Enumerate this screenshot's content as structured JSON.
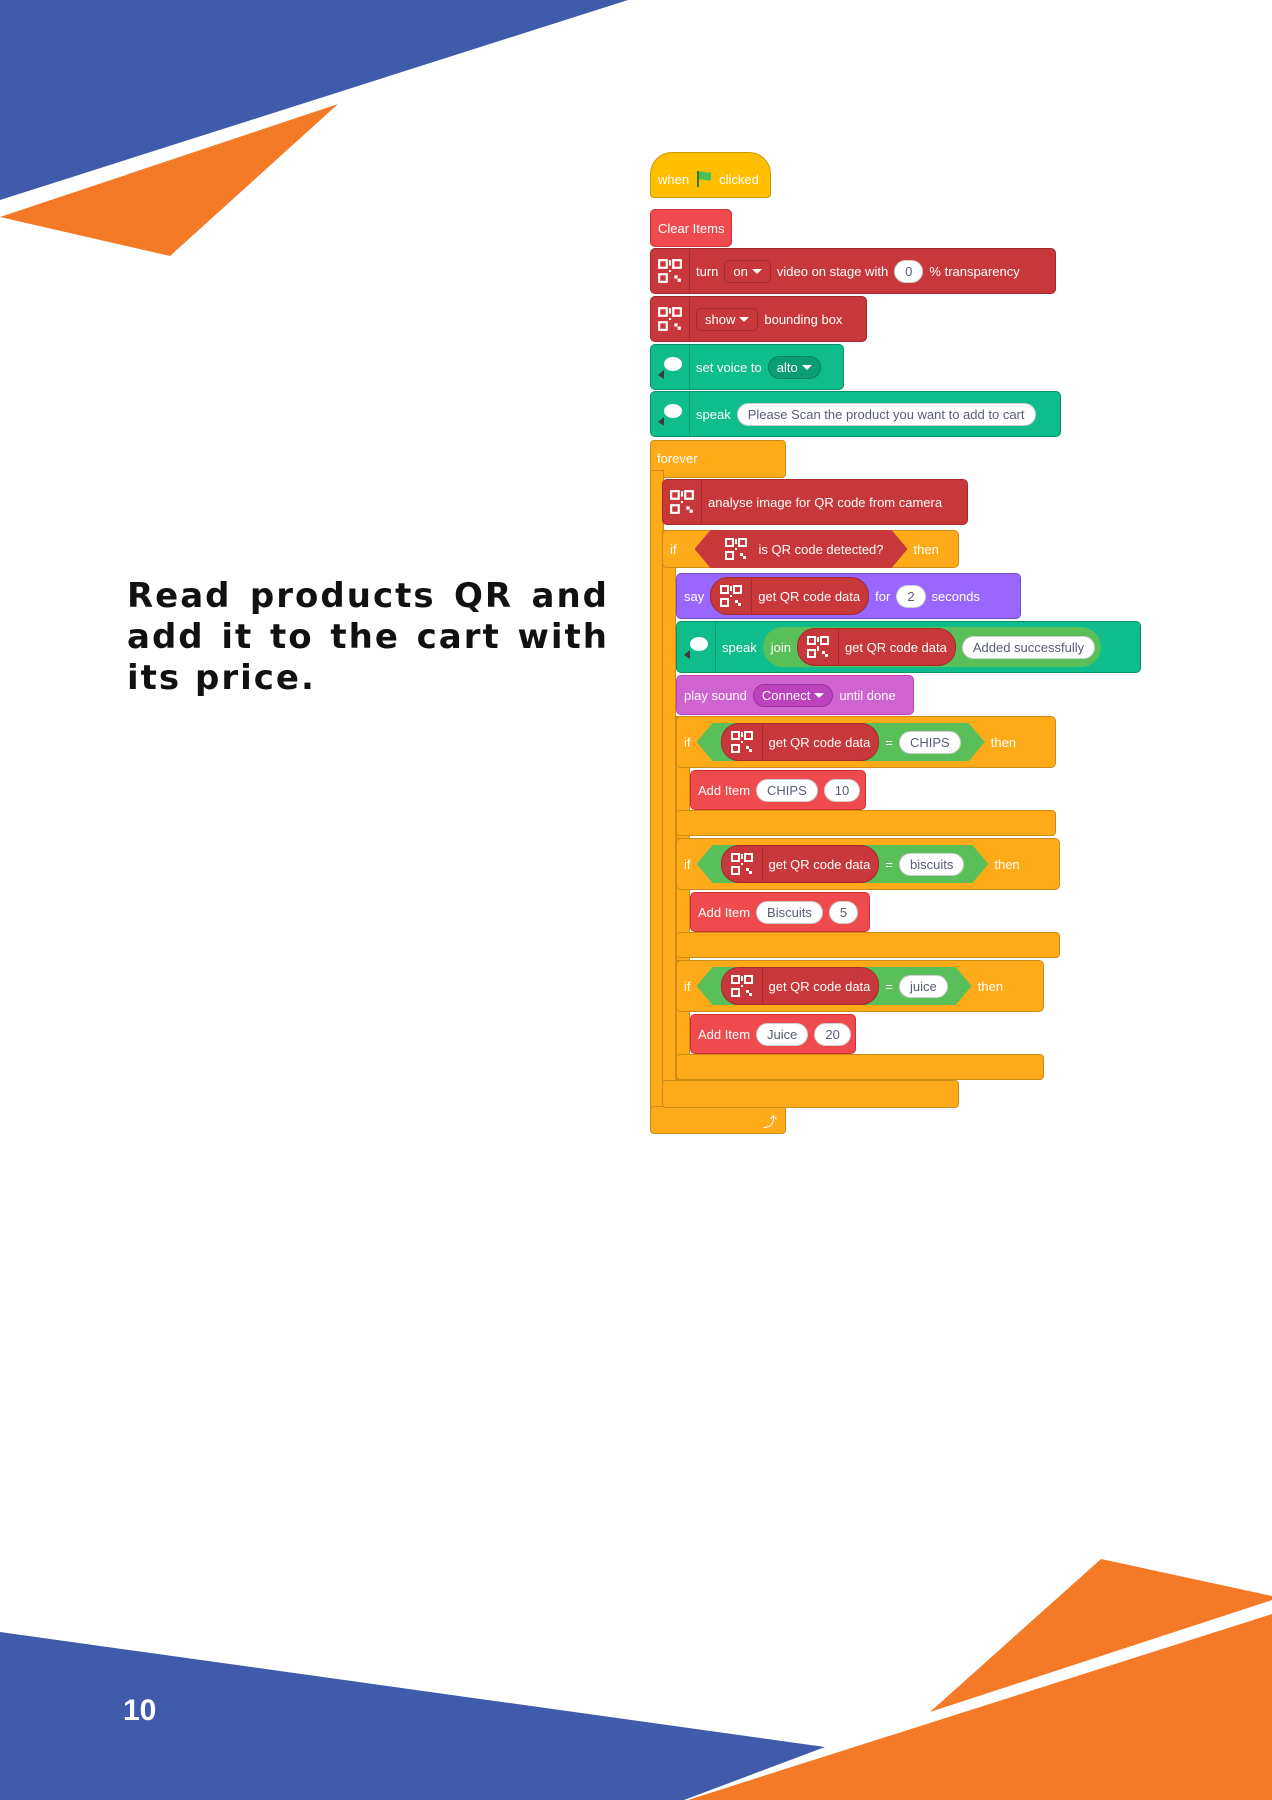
{
  "page": {
    "number": "10",
    "description": "Read products QR and add it to the cart with its price."
  },
  "colors": {
    "blue": "#3F5BA9",
    "orange": "#F47A27",
    "event": "#FFBF00",
    "control": "#FFAB19",
    "qr_ext": "#C8373A",
    "text2speech": "#0FBD8C",
    "looks": "#9966FF",
    "sound": "#CF63CF",
    "operator": "#59C059",
    "custom": "#EF4B4E"
  },
  "code": {
    "hat": {
      "when": "when",
      "clicked": "clicked",
      "flag_icon": "green-flag-icon"
    },
    "clear_items": "Clear Items",
    "video": {
      "turn": "turn",
      "state": "on",
      "mid": "video on stage with",
      "value": "0",
      "suffix": "% transparency"
    },
    "bbox": {
      "option": "show",
      "suffix": "bounding box"
    },
    "voice": {
      "label": "set voice to",
      "value": "alto"
    },
    "speak1": {
      "label": "speak",
      "text": "Please Scan the product you want to add to cart"
    },
    "forever": "forever",
    "analyse": "analyse image for QR code from camera",
    "if_label": "if",
    "then_label": "then",
    "detected": "is QR code detected?",
    "say": {
      "label": "say",
      "data": "get QR code data",
      "for": "for",
      "secs": "2",
      "seconds": "seconds"
    },
    "speak2": {
      "label": "speak",
      "join": "join",
      "data": "get QR code data",
      "text": "Added successfully"
    },
    "sound": {
      "label": "play sound",
      "value": "Connect",
      "suffix": "until done"
    },
    "equals": "=",
    "add_item": "Add Item",
    "products": [
      {
        "match": "CHIPS",
        "name": "CHIPS",
        "price": "10"
      },
      {
        "match": "biscuits",
        "name": "Biscuits",
        "price": "5"
      },
      {
        "match": "juice",
        "name": "Juice",
        "price": "20"
      }
    ]
  }
}
